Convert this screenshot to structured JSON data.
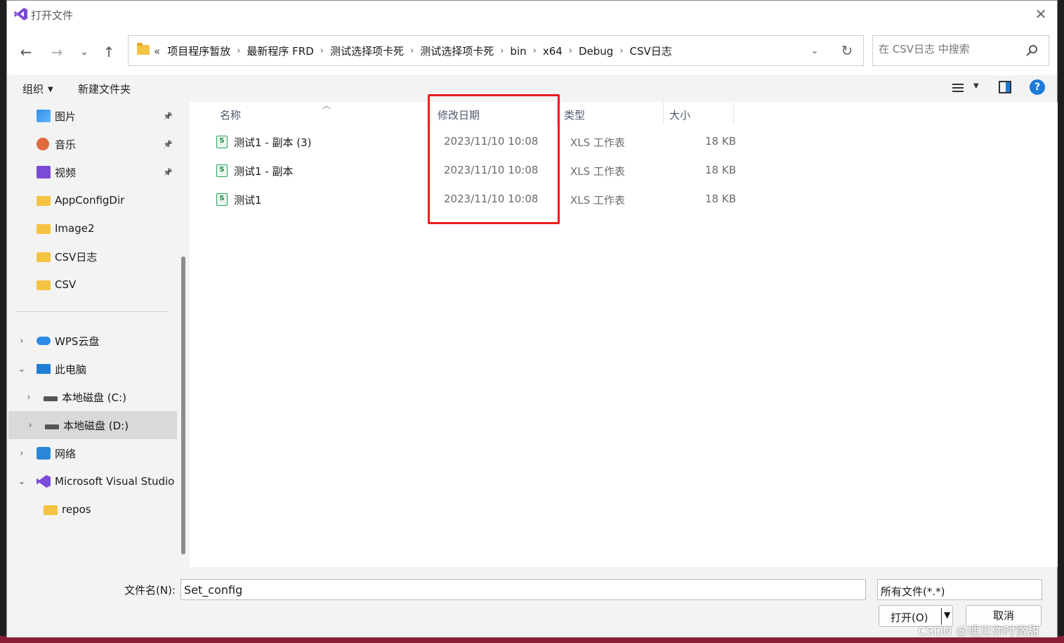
{
  "window": {
    "title": "打开文件"
  },
  "address_bar": {
    "overflow": "«",
    "crumbs": [
      "项目程序暂放",
      "最新程序 FRD",
      "测试选择项卡死",
      "测试选择项卡死",
      "bin",
      "x64",
      "Debug",
      "CSV日志"
    ]
  },
  "search": {
    "placeholder": "在 CSV日志 中搜索"
  },
  "toolbar": {
    "organize": "组织",
    "new_folder": "新建文件夹"
  },
  "sidebar": {
    "items": [
      {
        "label": "图片",
        "icon": "pictures-icon",
        "pinned": true
      },
      {
        "label": "音乐",
        "icon": "music-icon",
        "pinned": true
      },
      {
        "label": "视频",
        "icon": "video-icon",
        "pinned": true
      },
      {
        "label": "AppConfigDir",
        "icon": "folder-icon"
      },
      {
        "label": "Image2",
        "icon": "folder-icon"
      },
      {
        "label": "CSV日志",
        "icon": "folder-icon"
      },
      {
        "label": "CSV",
        "icon": "folder-icon"
      },
      {
        "label": "WPS云盘",
        "icon": "cloud-icon"
      },
      {
        "label": "此电脑",
        "icon": "computer-icon"
      },
      {
        "label": "本地磁盘 (C:)",
        "icon": "drive-icon"
      },
      {
        "label": "本地磁盘 (D:)",
        "icon": "drive-icon",
        "selected": true
      },
      {
        "label": "网络",
        "icon": "network-icon"
      },
      {
        "label": "Microsoft Visual Studio",
        "icon": "visual-studio-icon"
      },
      {
        "label": "repos",
        "icon": "folder-icon"
      }
    ]
  },
  "columns": {
    "name": "名称",
    "date": "修改日期",
    "type": "类型",
    "size": "大小"
  },
  "files": [
    {
      "name": "测试1 - 副本 (3)",
      "date": "2023/11/10 10:08",
      "type": "XLS 工作表",
      "size": "18 KB"
    },
    {
      "name": "测试1 - 副本",
      "date": "2023/11/10 10:08",
      "type": "XLS 工作表",
      "size": "18 KB"
    },
    {
      "name": "测试1",
      "date": "2023/11/10 10:08",
      "type": "XLS 工作表",
      "size": "18 KB"
    }
  ],
  "file_icon_glyph": "S",
  "footer": {
    "filename_label": "文件名(N):",
    "filename_value": "Set_config",
    "filetype_value": "所有文件(*.*)",
    "open_label": "打开(O)",
    "cancel_label": "取消"
  },
  "watermark": "CSDN @遇见你时微甜",
  "colors": {
    "accent": "#1e7ad8",
    "highlight_box": "#e8201d",
    "excel_green": "#26a55a"
  }
}
